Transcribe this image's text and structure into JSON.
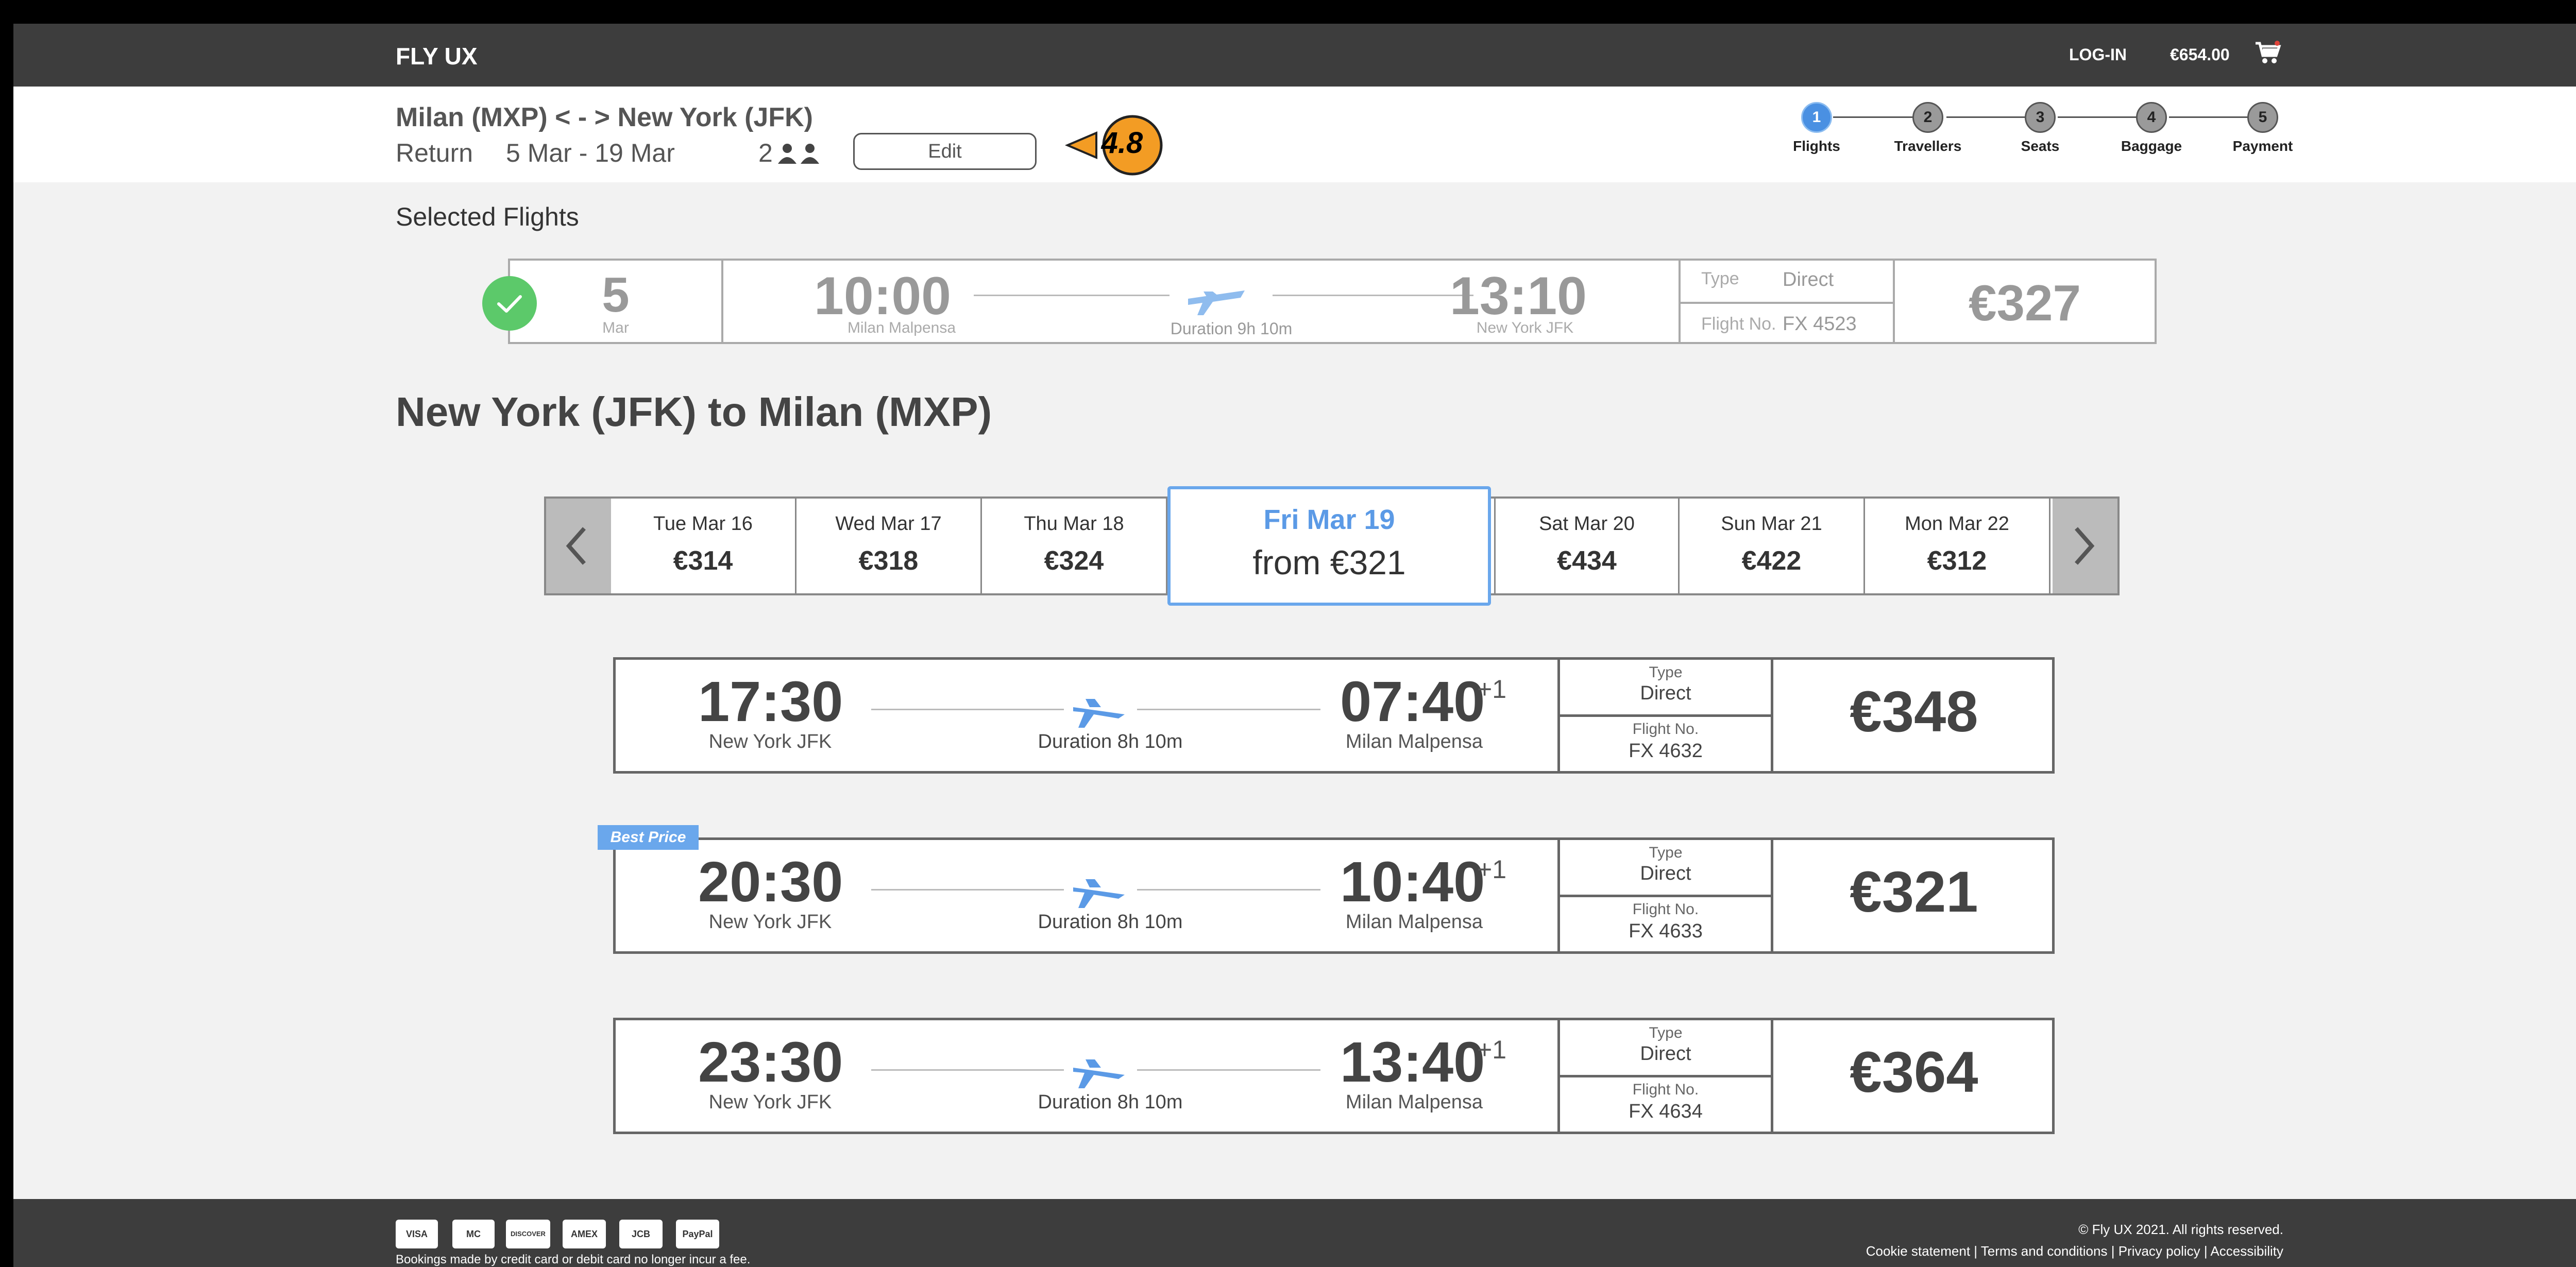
{
  "header": {
    "brand": "FLY UX",
    "login_label": "LOG-IN",
    "cart_total": "€654.00",
    "cart_icon": "cart-icon"
  },
  "trip": {
    "route": "Milan (MXP) < - > New York (JFK)",
    "type": "Return",
    "dates": "5 Mar - 19 Mar",
    "passengers": "2",
    "edit_label": "Edit",
    "rating": "4.8"
  },
  "steps": [
    {
      "number": "1",
      "label": "Flights",
      "active": true
    },
    {
      "number": "2",
      "label": "Travellers",
      "active": false
    },
    {
      "number": "3",
      "label": "Seats",
      "active": false
    },
    {
      "number": "4",
      "label": "Baggage",
      "active": false
    },
    {
      "number": "5",
      "label": "Payment",
      "active": false
    }
  ],
  "selected": {
    "title": "Selected Flights",
    "day": "5",
    "month": "Mar",
    "dep_time": "10:00",
    "dep_airport": "Milan Malpensa",
    "duration": "Duration 9h 10m",
    "arr_time": "13:10",
    "arr_airport": "New York JFK",
    "type_label": "Type",
    "type_value": "Direct",
    "flight_no_label": "Flight No.",
    "flight_no_value": "FX 4523",
    "price": "€327"
  },
  "return_leg": {
    "title": "New York (JFK) to Milan (MXP)",
    "dates": [
      {
        "label": "Tue Mar 16",
        "price": "€314"
      },
      {
        "label": "Wed Mar 17",
        "price": "€318"
      },
      {
        "label": "Thu Mar 18",
        "price": "€324"
      },
      {
        "label": "Fri Mar 19",
        "price": "from €321"
      },
      {
        "label": "Sat Mar 20",
        "price": "€434"
      },
      {
        "label": "Sun Mar 21",
        "price": "€422"
      },
      {
        "label": "Mon Mar 22",
        "price": "€312"
      }
    ],
    "selected_date_index": 3,
    "best_price_label": "Best Price",
    "flights": [
      {
        "dep_time": "17:30",
        "dep_airport": "New York JFK",
        "duration": "Duration 8h 10m",
        "arr_time": "07:40",
        "day_offset": "+1",
        "arr_airport": "Milan Malpensa",
        "type_label": "Type",
        "type_value": "Direct",
        "flight_no_label": "Flight No.",
        "flight_no_value": "FX 4632",
        "price": "€348",
        "best_price": false
      },
      {
        "dep_time": "20:30",
        "dep_airport": "New York JFK",
        "duration": "Duration 8h 10m",
        "arr_time": "10:40",
        "day_offset": "+1",
        "arr_airport": "Milan Malpensa",
        "type_label": "Type",
        "type_value": "Direct",
        "flight_no_label": "Flight No.",
        "flight_no_value": "FX 4633",
        "price": "€321",
        "best_price": true
      },
      {
        "dep_time": "23:30",
        "dep_airport": "New York JFK",
        "duration": "Duration 8h 10m",
        "arr_time": "13:40",
        "day_offset": "+1",
        "arr_airport": "Milan Malpensa",
        "type_label": "Type",
        "type_value": "Direct",
        "flight_no_label": "Flight No.",
        "flight_no_value": "FX 4634",
        "price": "€364",
        "best_price": false
      }
    ]
  },
  "footer": {
    "payment_methods": [
      "VISA",
      "MC",
      "DISCOVER",
      "AMEX",
      "JCB",
      "PayPal"
    ],
    "note": "Bookings made by credit card or debit card no longer incur a fee.",
    "copyright": "© Fly UX 2021. All rights reserved.",
    "links": [
      "Cookie statement",
      "Terms and conditions",
      "Privacy policy",
      "Accessibility"
    ]
  },
  "colors": {
    "topbar": "#3d3d3d",
    "accent": "#4a90e2",
    "accent_light": "#6aa7ec",
    "check": "#5cc96a",
    "badge": "#f39c24"
  }
}
